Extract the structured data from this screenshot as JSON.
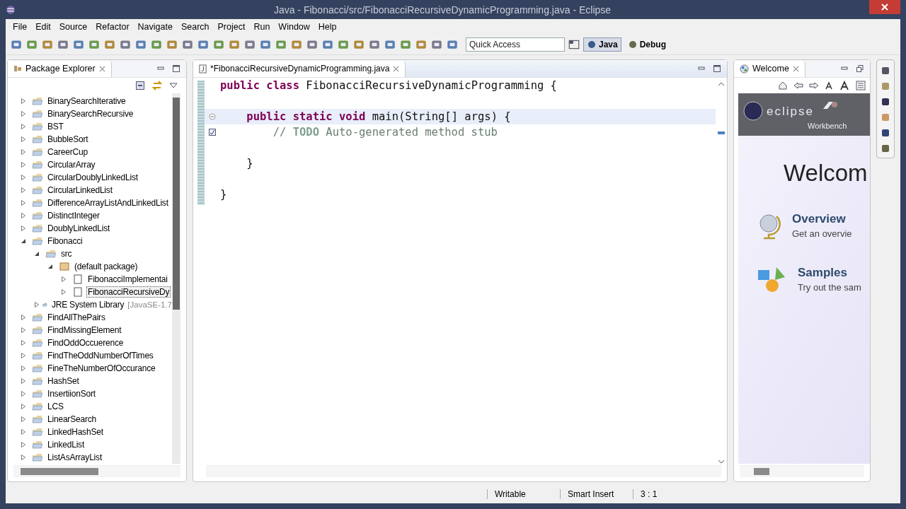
{
  "window": {
    "title": "Java - Fibonacci/src/FibonacciRecursiveDynamicProgramming.java - Eclipse"
  },
  "menu": [
    "File",
    "Edit",
    "Source",
    "Refactor",
    "Navigate",
    "Search",
    "Project",
    "Run",
    "Window",
    "Help"
  ],
  "toolbar": {
    "quick_access": {
      "placeholder": "Quick Access"
    },
    "perspectives": [
      {
        "label": "Java",
        "selected": true
      },
      {
        "label": "Debug",
        "selected": false
      }
    ]
  },
  "package_explorer": {
    "title": "Package Explorer",
    "tree": [
      {
        "label": "BinarySearchIterative",
        "kind": "project",
        "expanded": false
      },
      {
        "label": "BinarySearchRecursive",
        "kind": "project",
        "expanded": false
      },
      {
        "label": "BST",
        "kind": "project",
        "expanded": false
      },
      {
        "label": "BubbleSort",
        "kind": "project",
        "expanded": false
      },
      {
        "label": "CareerCup",
        "kind": "project",
        "expanded": false
      },
      {
        "label": "CircularArray",
        "kind": "project",
        "expanded": false
      },
      {
        "label": "CircularDoublyLinkedList",
        "kind": "project",
        "expanded": false
      },
      {
        "label": "CircularLinkedList",
        "kind": "project",
        "expanded": false
      },
      {
        "label": "DifferenceArrayListAndLinkedList",
        "kind": "project",
        "expanded": false
      },
      {
        "label": "DistinctInteger",
        "kind": "project",
        "expanded": false
      },
      {
        "label": "DoublyLinkedList",
        "kind": "project",
        "expanded": false
      },
      {
        "label": "Fibonacci",
        "kind": "project",
        "expanded": true,
        "children": [
          {
            "label": "src",
            "kind": "source",
            "expanded": true,
            "children": [
              {
                "label": "(default package)",
                "kind": "package",
                "expanded": true,
                "children": [
                  {
                    "label": "FibonacciImplementai",
                    "kind": "file",
                    "expanded": false,
                    "selected": false
                  },
                  {
                    "label": "FibonacciRecursiveDy",
                    "kind": "file",
                    "expanded": false,
                    "selected": true
                  }
                ]
              }
            ]
          },
          {
            "label": "JRE System Library",
            "suffix": "[JavaSE-1.7",
            "kind": "library",
            "expanded": false
          }
        ]
      },
      {
        "label": "FindAllThePairs",
        "kind": "project",
        "expanded": false
      },
      {
        "label": "FindMissingElement",
        "kind": "project",
        "expanded": false
      },
      {
        "label": "FindOddOccuerence",
        "kind": "project",
        "expanded": false
      },
      {
        "label": "FindTheOddNumberOfTimes",
        "kind": "project",
        "expanded": false
      },
      {
        "label": "FineTheNumberOfOccurance",
        "kind": "project",
        "expanded": false
      },
      {
        "label": "HashSet",
        "kind": "project",
        "expanded": false
      },
      {
        "label": "InsertiionSort",
        "kind": "project",
        "expanded": false
      },
      {
        "label": "LCS",
        "kind": "project",
        "expanded": false
      },
      {
        "label": "LinearSearch",
        "kind": "project",
        "expanded": false
      },
      {
        "label": "LinkedHashSet",
        "kind": "project",
        "expanded": false
      },
      {
        "label": "LinkedList",
        "kind": "project",
        "expanded": false
      },
      {
        "label": "ListAsArrayList",
        "kind": "project",
        "expanded": false
      }
    ]
  },
  "editor": {
    "tab": "*FibonacciRecursiveDynamicProgramming.java",
    "lines": [
      {
        "text": "**public** **class** FibonacciRecursiveDynamicProgramming {",
        "kind": "code",
        "current": false,
        "collapsible": false,
        "task": false
      },
      {
        "current": false,
        "collapsible": false,
        "task": false
      },
      {
        "text": "    **public** **static** **void** main(String[] args) {",
        "kind": "code",
        "current": true,
        "collapsible": true,
        "task": false
      },
      {
        "text": "        // **TODO** Auto-generated method stub",
        "kind": "comment",
        "current": false,
        "collapsible": false,
        "task": true
      },
      {
        "current": false,
        "collapsible": false,
        "task": false
      },
      {
        "text": "    }",
        "kind": "code",
        "current": false,
        "collapsible": false,
        "task": false
      },
      {
        "current": false,
        "collapsible": false,
        "task": false
      },
      {
        "text": "}",
        "kind": "code",
        "current": false,
        "collapsible": false,
        "task": false
      }
    ]
  },
  "welcome": {
    "tab": "Welcome",
    "banner_logo": "eclipse",
    "banner_caption": "Workbench",
    "heading": "Welcom",
    "items": [
      {
        "kind": "overview",
        "title": "Overview",
        "text": "Get an overvie"
      },
      {
        "kind": "samples",
        "title": "Samples",
        "text": "Try out the sam"
      }
    ]
  },
  "status_bar": [
    "Writable",
    "Smart Insert",
    "3 : 1"
  ]
}
